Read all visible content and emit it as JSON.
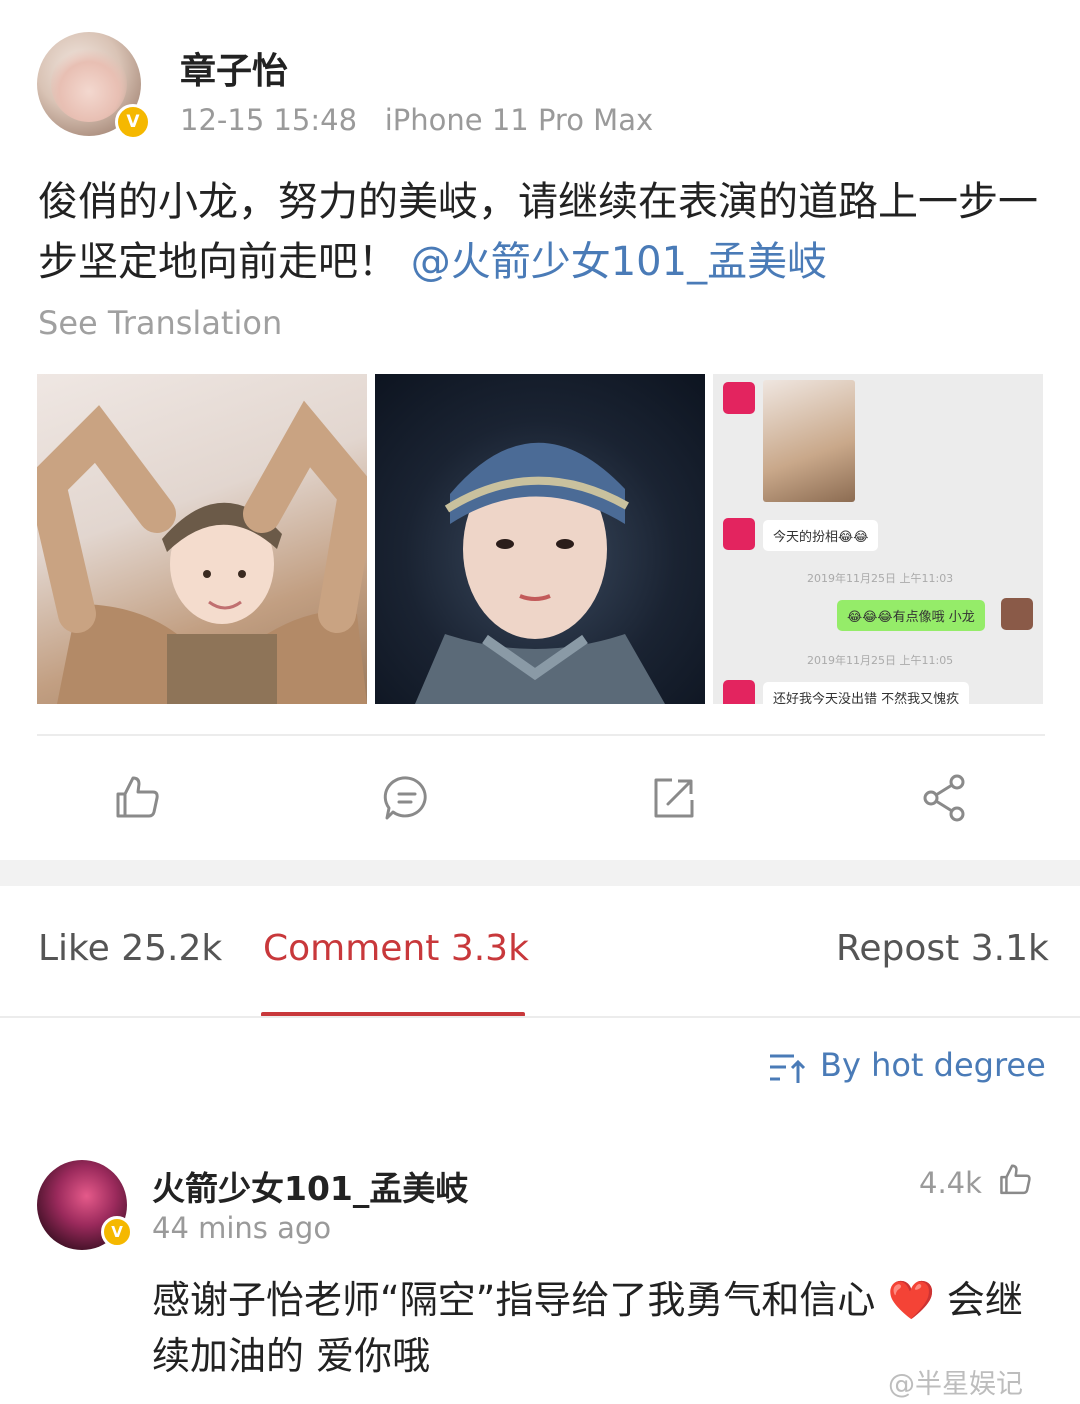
{
  "post": {
    "author": "章子怡",
    "timestamp": "12-15 15:48",
    "device": "iPhone 11 Pro Max",
    "text": "俊俏的小龙，努力的美岐，请继续在表演的道路上一步一步坚定地向前走吧！",
    "mention": "@火箭少女101_孟美岐",
    "see_translation": "See Translation",
    "verified_badge": "V"
  },
  "chat_screenshot": {
    "msg1": "今天的扮相😂😂",
    "time1": "2019年11月25日 上午11:03",
    "msg2": "😂😂😂有点像哦 小龙",
    "time2": "2019年11月25日 上午11:05",
    "msg3": "还好我今天没出错 不然我又愧疚"
  },
  "actions": {
    "like_icon": "thumbs-up-icon",
    "comment_icon": "comment-icon",
    "repost_icon": "repost-icon",
    "share_icon": "share-icon"
  },
  "tabs": {
    "like": "Like 25.2k",
    "comment": "Comment 3.3k",
    "repost": "Repost 3.1k"
  },
  "sort": {
    "label": "By hot degree"
  },
  "comment": {
    "author": "火箭少女101_孟美岐",
    "time": "44 mins ago",
    "likes": "4.4k",
    "text_part1": "感谢子怡老师“隔空”指导给了我勇气和信心 ",
    "emoji": "❤️",
    "text_part2": " 会继续加油的 爱你哦",
    "verified_badge": "V"
  },
  "watermark": "@半星娱记",
  "colors": {
    "accent_red": "#c8383b",
    "link_blue": "#4a7bb7",
    "verified_gold": "#f5b800"
  }
}
